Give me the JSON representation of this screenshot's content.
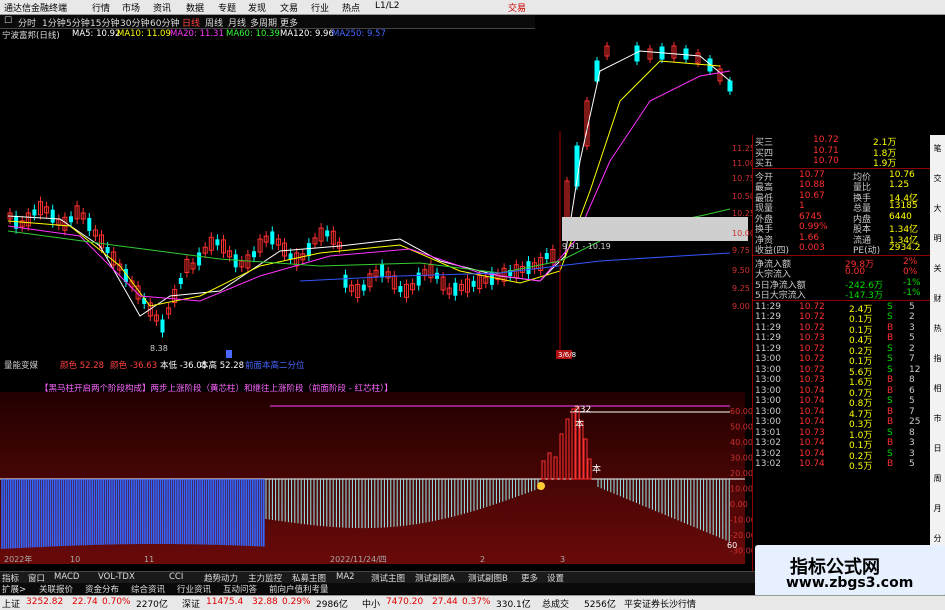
{
  "app": {
    "title": "通达信金融终端",
    "menus": [
      "行情",
      "市场",
      "资讯",
      "数据",
      "专题",
      "发现",
      "文易",
      "行业",
      "热点",
      "L1/L2"
    ],
    "right_menu": "交易"
  },
  "toolbar": {
    "items": [
      "分时",
      "1分钟",
      "5分钟",
      "15分钟",
      "30分钟",
      "60分钟",
      "日线",
      "周线",
      "月线",
      "多周期",
      "更多"
    ],
    "active": "日线"
  },
  "stock": {
    "name": "宁波富邦(日线)",
    "ma": [
      {
        "label": "MA5: 10.92",
        "color": "#ffffff"
      },
      {
        "label": "MA10: 11.09",
        "color": "#ffff00"
      },
      {
        "label": "MA20: 11.31",
        "color": "#ff33ff"
      },
      {
        "label": "MA60: 10.39",
        "color": "#33ff33"
      },
      {
        "label": "MA120: 9.96",
        "color": "#ffffff"
      },
      {
        "label": "MA250: 9.57",
        "color": "#4466ff"
      }
    ]
  },
  "chart_labels": {
    "low_price": "8.38",
    "band_label": "9.91 - 10.19",
    "date_tag": "3/6/8"
  },
  "price_axis": [
    "11.25",
    "11.00",
    "10.75",
    "10.50",
    "10.25",
    "10.00",
    "9.75",
    "9.50",
    "9.25",
    "9.00"
  ],
  "indicator": {
    "name": "量能变媒",
    "header": [
      {
        "text": "颜色 52.28",
        "color": "#ff4040"
      },
      {
        "text": "颜色 -36.63",
        "color": "#ff4040"
      },
      {
        "text": "本低 -36.05",
        "color": "#ffffff"
      },
      {
        "text": "本高 52.28",
        "color": "#ffffff"
      },
      {
        "text": "前面本高二分位",
        "color": "#4466ff"
      }
    ],
    "title": "【黑马柱开启两个阶段构成】两步上涨阶段（黄芯柱）和继往上涨阶段（前面阶段 - 红芯柱）】",
    "peak": "232",
    "mark_top": "本",
    "mark_mid": "本",
    "axis": [
      "60.00",
      "50.00",
      "40.00",
      "30.00",
      "20.00",
      "10.00",
      "0.00",
      "-10.00",
      "-20.00",
      "-30.00"
    ],
    "date_axis": [
      "2022年",
      "10",
      "11",
      "2022/11/24/四",
      "2",
      "3"
    ],
    "last": "60"
  },
  "quote": {
    "top": [
      {
        "l": "买三",
        "p": "10.72",
        "v": "2.1万"
      },
      {
        "l": "买四",
        "p": "10.71",
        "v": "1.8万"
      },
      {
        "l": "买五",
        "p": "10.70",
        "v": "1.9万"
      }
    ],
    "stats": [
      {
        "a": "今开",
        "b": "10.77",
        "c": "均价",
        "d": "10.76"
      },
      {
        "a": "最高",
        "b": "10.88",
        "c": "量比",
        "d": "1.25"
      },
      {
        "a": "最低",
        "b": "10.67",
        "c": "换手",
        "d": "14.4亿"
      },
      {
        "a": "现量",
        "b": "1",
        "c": "总量",
        "d": "13185"
      },
      {
        "a": "外盘",
        "b": "6745",
        "c": "内盘",
        "d": "6440"
      },
      {
        "a": "换手",
        "b": "0.99%",
        "c": "股本",
        "d": "1.34亿"
      },
      {
        "a": "净资",
        "b": "1.66",
        "c": "流通",
        "d": "1.34亿"
      },
      {
        "a": "收益(四)",
        "b": "0.003",
        "c": "PE(动)",
        "d": "2934.2"
      }
    ],
    "flow": [
      {
        "l": "净流入额",
        "v": "29.8万",
        "p": "2%"
      },
      {
        "l": "大宗流入",
        "v": "0.00",
        "p": "0%"
      },
      {
        "l": "5日净流入额",
        "v": "-242.6万",
        "p": "-1%"
      },
      {
        "l": "5日大宗流入",
        "v": "-147.3万",
        "p": "-1%"
      }
    ],
    "ticks": [
      {
        "t": "11:29",
        "p": "10.72",
        "v": "2.4万",
        "s": "S",
        "n": "5"
      },
      {
        "t": "11:29",
        "p": "10.72",
        "v": "0.1万",
        "s": "S",
        "n": "2"
      },
      {
        "t": "11:29",
        "p": "10.72",
        "v": "0.1万",
        "s": "B",
        "n": "3"
      },
      {
        "t": "11:29",
        "p": "10.73",
        "v": "0.4万",
        "s": "B",
        "n": "5"
      },
      {
        "t": "11:29",
        "p": "10.72",
        "v": "0.2万",
        "s": "S",
        "n": "2"
      },
      {
        "t": "13:00",
        "p": "10.72",
        "v": "0.1万",
        "s": "S",
        "n": "7"
      },
      {
        "t": "13:00",
        "p": "10.72",
        "v": "5.6万",
        "s": "S",
        "n": "12"
      },
      {
        "t": "13:00",
        "p": "10.73",
        "v": "1.6万",
        "s": "B",
        "n": "8"
      },
      {
        "t": "13:00",
        "p": "10.74",
        "v": "0.7万",
        "s": "B",
        "n": "6"
      },
      {
        "t": "13:00",
        "p": "10.74",
        "v": "0.8万",
        "s": "S",
        "n": "5"
      },
      {
        "t": "13:00",
        "p": "10.74",
        "v": "4.7万",
        "s": "B",
        "n": "7"
      },
      {
        "t": "13:00",
        "p": "10.74",
        "v": "0.3万",
        "s": "B",
        "n": "25"
      },
      {
        "t": "13:01",
        "p": "10.73",
        "v": "1.0万",
        "s": "S",
        "n": "8"
      },
      {
        "t": "13:02",
        "p": "10.74",
        "v": "0.1万",
        "s": "B",
        "n": "3"
      },
      {
        "t": "13:02",
        "p": "10.74",
        "v": "0.2万",
        "s": "S",
        "n": "3"
      },
      {
        "t": "13:02",
        "p": "10.74",
        "v": "0.5万",
        "s": "B",
        "n": "5"
      }
    ]
  },
  "sidebar": [
    "笔",
    "交",
    "大",
    "明",
    "关",
    "财",
    "热",
    "指",
    "相",
    "市",
    "日",
    "周",
    "月",
    "分"
  ],
  "tabs": [
    "指标",
    "窗口",
    "MACD",
    "VOL-TDX",
    "CCI",
    "趋势动力",
    "主力监控",
    "私募主图",
    "MA2",
    "测试主图",
    "测试副图A",
    "测试副图B",
    "更多",
    "设置"
  ],
  "links": [
    "扩展>",
    "关联报价",
    "资金分布",
    "综合资讯",
    "行业资讯",
    "互动问答",
    "前向户值利考量"
  ],
  "status": [
    {
      "label": "上证",
      "val": "3252.82",
      "chg": "22.74",
      "pct": "0.70%",
      "amt": "2270亿"
    },
    {
      "label": "深证",
      "val": "11475.4",
      "chg": "32.88",
      "pct": "0.29%",
      "amt": "2986亿"
    },
    {
      "label": "中小",
      "val": "7470.20",
      "chg": "27.44",
      "pct": "0.37%",
      "amt": "330.1亿"
    }
  ],
  "status_extra": {
    "total_label": "总成交",
    "total_val": "5256亿",
    "broker": "平安证券长沙行情"
  },
  "watermark": {
    "line1": "指标公式网",
    "line2": "www.zbgs3.com"
  },
  "colors": {
    "up": "#ff3030",
    "down": "#00ffff",
    "panel_border": "#8b0000"
  }
}
